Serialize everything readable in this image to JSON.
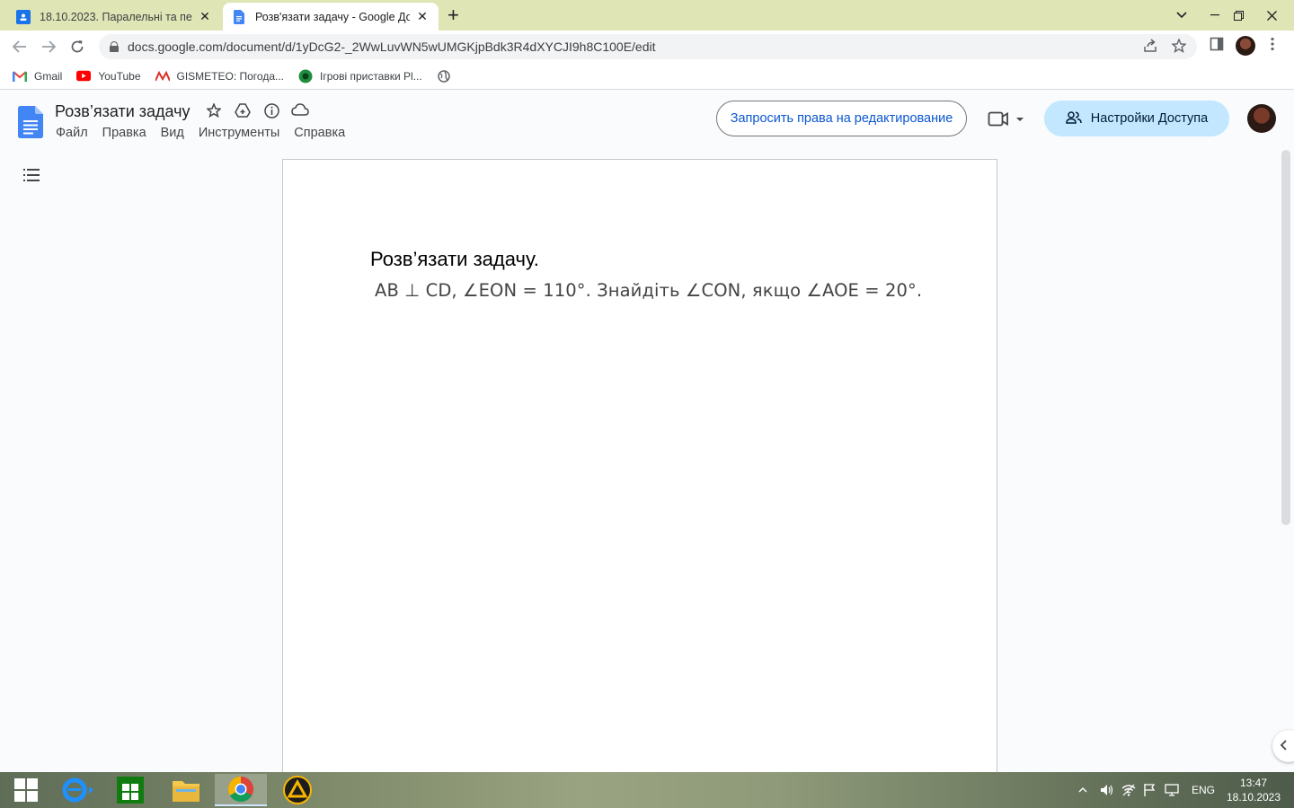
{
  "browser": {
    "tabs": [
      {
        "title": "18.10.2023. Паралельні та перпе",
        "active": false
      },
      {
        "title": "Розв'язати задачу - Google Док",
        "active": true
      }
    ],
    "url": "docs.google.com/document/d/1yDcG2-_2WwLuvWN5wUMGKjpBdk3R4dXYCJI9h8C100E/edit",
    "bookmarks": [
      {
        "label": "Gmail",
        "icon": "gmail-icon"
      },
      {
        "label": "YouTube",
        "icon": "youtube-icon"
      },
      {
        "label": "GISMETEO: Погода...",
        "icon": "gismeteo-icon"
      },
      {
        "label": "Ігрові приставки Pl...",
        "icon": "console-icon"
      }
    ]
  },
  "docs": {
    "title": "Розв’язати задачу",
    "menus": [
      "Файл",
      "Правка",
      "Вид",
      "Инструменты",
      "Справка"
    ],
    "request_edit_label": "Запросить права на редактирование",
    "share_label": "Настройки Доступа"
  },
  "document": {
    "heading": "Розв’язати задачу.",
    "problem": "AB ⊥ CD, ∠EON = 110°. Знайдіть ∠CON, якщо ∠AOE = 20°."
  },
  "taskbar": {
    "lang": "ENG",
    "time": "13:47",
    "date": "18.10.2023"
  },
  "colors": {
    "tabstrip": "#dfe5b5",
    "accent": "#0b57d0",
    "share_bg": "#c2e7ff"
  }
}
